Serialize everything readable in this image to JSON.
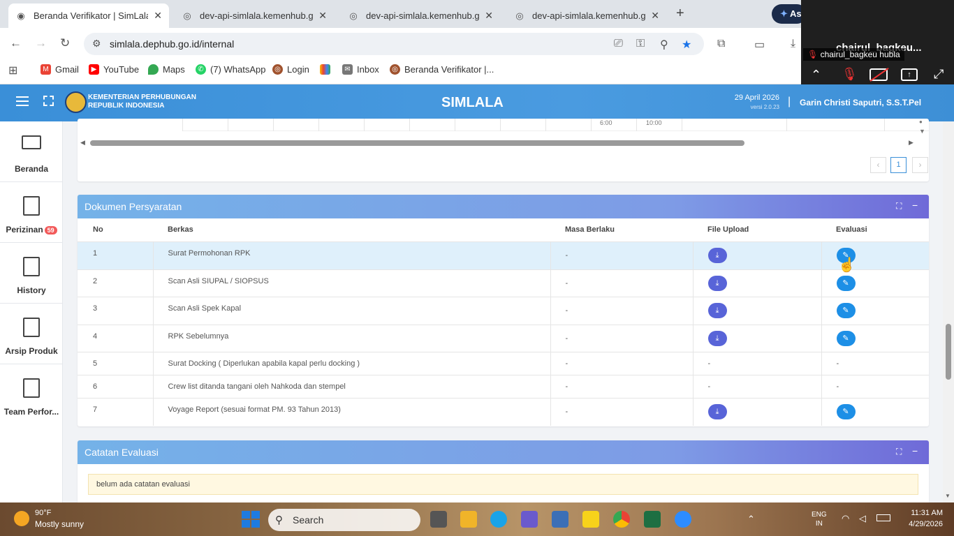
{
  "browser": {
    "tabs": [
      {
        "title": "Beranda Verifikator | SimLala",
        "active": true
      },
      {
        "title": "dev-api-simlala.kemenhub.go.id",
        "active": false
      },
      {
        "title": "dev-api-simlala.kemenhub.go.id",
        "active": false
      },
      {
        "title": "dev-api-simlala.kemenhub.go.id",
        "active": false
      },
      {
        "title": "As",
        "active": false
      }
    ],
    "url": "simlala.dephub.go.id/internal",
    "bookmarks": [
      "Gmail",
      "YouTube",
      "Maps",
      "(7) WhatsApp",
      "Login",
      "Inbox",
      "Beranda Verifikator |..."
    ]
  },
  "zoom_overlay": {
    "name_big": "chairul_bagkeu...",
    "name_small": "chairul_bagkeu hubla"
  },
  "header": {
    "org_line1": "KEMENTERIAN PERHUBUNGAN",
    "org_line2": "REPUBLIK INDONESIA",
    "app_title": "SIMLALA",
    "date": "29 April 2026",
    "version": "versi 2.0.23",
    "separator": "|",
    "user": "Garin Christi Saputri, S.S.T.Pel"
  },
  "sidebar": {
    "items": [
      {
        "label": "Beranda"
      },
      {
        "label": "Perizinan",
        "badge": "59"
      },
      {
        "label": "History"
      },
      {
        "label": "Arsip Produk"
      },
      {
        "label": "Team Perfor..."
      }
    ]
  },
  "top_table": {
    "partial_cells": [
      "6:00",
      "10:00"
    ],
    "page": "1",
    "prev": "‹",
    "next": "›"
  },
  "dokumen": {
    "title": "Dokumen Persyaratan",
    "columns": [
      "No",
      "Berkas",
      "Masa Berlaku",
      "File Upload",
      "Evaluasi"
    ],
    "rows": [
      {
        "no": "1",
        "berkas": "Surat Permohonan RPK",
        "masa": "-",
        "upload": "btn",
        "evaluasi": "btn"
      },
      {
        "no": "2",
        "berkas": "Scan Asli SIUPAL / SIOPSUS",
        "masa": "-",
        "upload": "btn",
        "evaluasi": "btn"
      },
      {
        "no": "3",
        "berkas": "Scan Asli Spek Kapal",
        "masa": "-",
        "upload": "btn",
        "evaluasi": "btn"
      },
      {
        "no": "4",
        "berkas": "RPK Sebelumnya",
        "masa": "-",
        "upload": "btn",
        "evaluasi": "btn"
      },
      {
        "no": "5",
        "berkas": "Surat Docking ( Diperlukan apabila kapal perlu docking )",
        "masa": "-",
        "upload": "-",
        "evaluasi": "-"
      },
      {
        "no": "6",
        "berkas": "Crew list ditanda tangani oleh Nahkoda dan stempel",
        "masa": "-",
        "upload": "-",
        "evaluasi": "-"
      },
      {
        "no": "7",
        "berkas": "Voyage Report (sesuai format PM. 93 Tahun 2013)",
        "masa": "-",
        "upload": "btn",
        "evaluasi": "btn"
      }
    ]
  },
  "catatan": {
    "title": "Catatan Evaluasi",
    "message": "belum ada catatan evaluasi"
  },
  "taskbar": {
    "weather_temp": "90°F",
    "weather_desc": "Mostly sunny",
    "search": "Search",
    "lang1": "ENG",
    "lang2": "IN",
    "time": "11:31 AM",
    "date": "4/29/2026"
  },
  "colors": {
    "header_blue": "#3a8fd8",
    "download_button": "#5864d8",
    "evaluasi_button": "#1d8fe6",
    "badge_red": "#f25a5a"
  }
}
